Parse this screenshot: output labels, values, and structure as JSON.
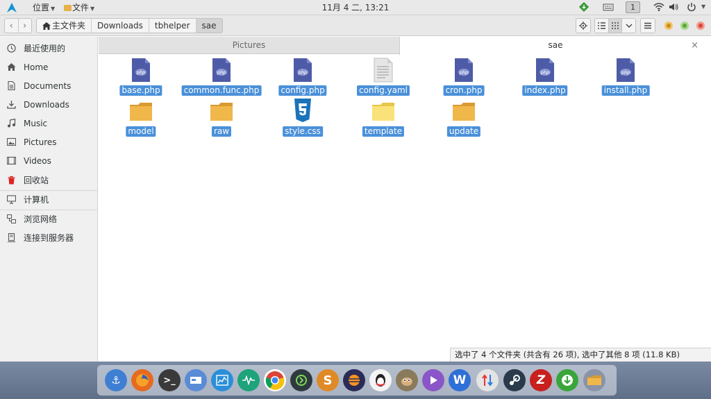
{
  "top_panel": {
    "places_menu": "位置",
    "files_menu": "文件",
    "clock": "11月 4 二, 13:21",
    "workspace": "1"
  },
  "pathbar": {
    "crumbs": [
      "主文件夹",
      "Downloads",
      "tbhelper",
      "sae"
    ]
  },
  "sidebar": {
    "items": [
      {
        "label": "最近使用的",
        "icon": "recent-icon"
      },
      {
        "label": "Home",
        "icon": "home-icon"
      },
      {
        "label": "Documents",
        "icon": "documents-icon"
      },
      {
        "label": "Downloads",
        "icon": "downloads-icon"
      },
      {
        "label": "Music",
        "icon": "music-icon"
      },
      {
        "label": "Pictures",
        "icon": "pictures-icon"
      },
      {
        "label": "Videos",
        "icon": "videos-icon"
      },
      {
        "label": "回收站",
        "icon": "trash-icon"
      },
      {
        "label": "计算机",
        "icon": "computer-icon"
      },
      {
        "label": "浏览网络",
        "icon": "network-icon"
      },
      {
        "label": "连接到服务器",
        "icon": "server-icon"
      }
    ]
  },
  "tabs": [
    {
      "label": "Pictures",
      "active": false
    },
    {
      "label": "sae",
      "active": true
    }
  ],
  "files": [
    {
      "name": "base.php",
      "type": "php"
    },
    {
      "name": "common.func.php",
      "type": "php"
    },
    {
      "name": "config.php",
      "type": "php"
    },
    {
      "name": "config.yaml",
      "type": "text"
    },
    {
      "name": "cron.php",
      "type": "php"
    },
    {
      "name": "index.php",
      "type": "php"
    },
    {
      "name": "install.php",
      "type": "php"
    },
    {
      "name": "model",
      "type": "folder"
    },
    {
      "name": "raw",
      "type": "folder"
    },
    {
      "name": "style.css",
      "type": "css"
    },
    {
      "name": "template",
      "type": "folder-light"
    },
    {
      "name": "update",
      "type": "folder"
    }
  ],
  "status_text": "选中了 4 个文件夹 (共含有 26 项), 选中了其他 8 项 (11.8 KB)",
  "dock": [
    {
      "name": "anchor-app-icon",
      "glyph": "⚓",
      "color": "#3f7fd3"
    },
    {
      "name": "firefox-icon",
      "glyph": "",
      "color": "#e66a1f"
    },
    {
      "name": "terminal-icon",
      "glyph": ">_",
      "color": "#3a3a3a"
    },
    {
      "name": "window-app-icon",
      "glyph": "▭",
      "color": "#5a8bd6"
    },
    {
      "name": "system-monitor-icon",
      "glyph": "▟",
      "color": "#2a8fd8"
    },
    {
      "name": "pulse-app-icon",
      "glyph": "∿",
      "color": "#1ea37a"
    },
    {
      "name": "chrome-icon",
      "glyph": "",
      "color": "#d8463a"
    },
    {
      "name": "code-app-icon",
      "glyph": "›",
      "color": "#2f3a3f"
    },
    {
      "name": "sublime-icon",
      "glyph": "S",
      "color": "#e08a27"
    },
    {
      "name": "eclipse-icon",
      "glyph": "☰",
      "color": "#2b2b57"
    },
    {
      "name": "qq-icon",
      "glyph": "◕",
      "color": "#f2f2f2"
    },
    {
      "name": "gimp-icon",
      "glyph": "◔",
      "color": "#8a7a5c"
    },
    {
      "name": "media-player-icon",
      "glyph": "▶",
      "color": "#8a55c9"
    },
    {
      "name": "wps-icon",
      "glyph": "W",
      "color": "#2f6fd8"
    },
    {
      "name": "transfer-icon",
      "glyph": "⇅",
      "color": "#e4e4e4"
    },
    {
      "name": "steam-icon",
      "glyph": "⚙",
      "color": "#2a3a4a"
    },
    {
      "name": "filezilla-icon",
      "glyph": "Z",
      "color": "#c8201f"
    },
    {
      "name": "download-manager-icon",
      "glyph": "⬇",
      "color": "#3aa63a"
    },
    {
      "name": "files-icon",
      "glyph": "▬",
      "color": "#8a93a7"
    }
  ],
  "colors": {
    "selection": "#4a90d9",
    "php_icon": "#4e5ba6",
    "folder": "#f0b74a"
  }
}
